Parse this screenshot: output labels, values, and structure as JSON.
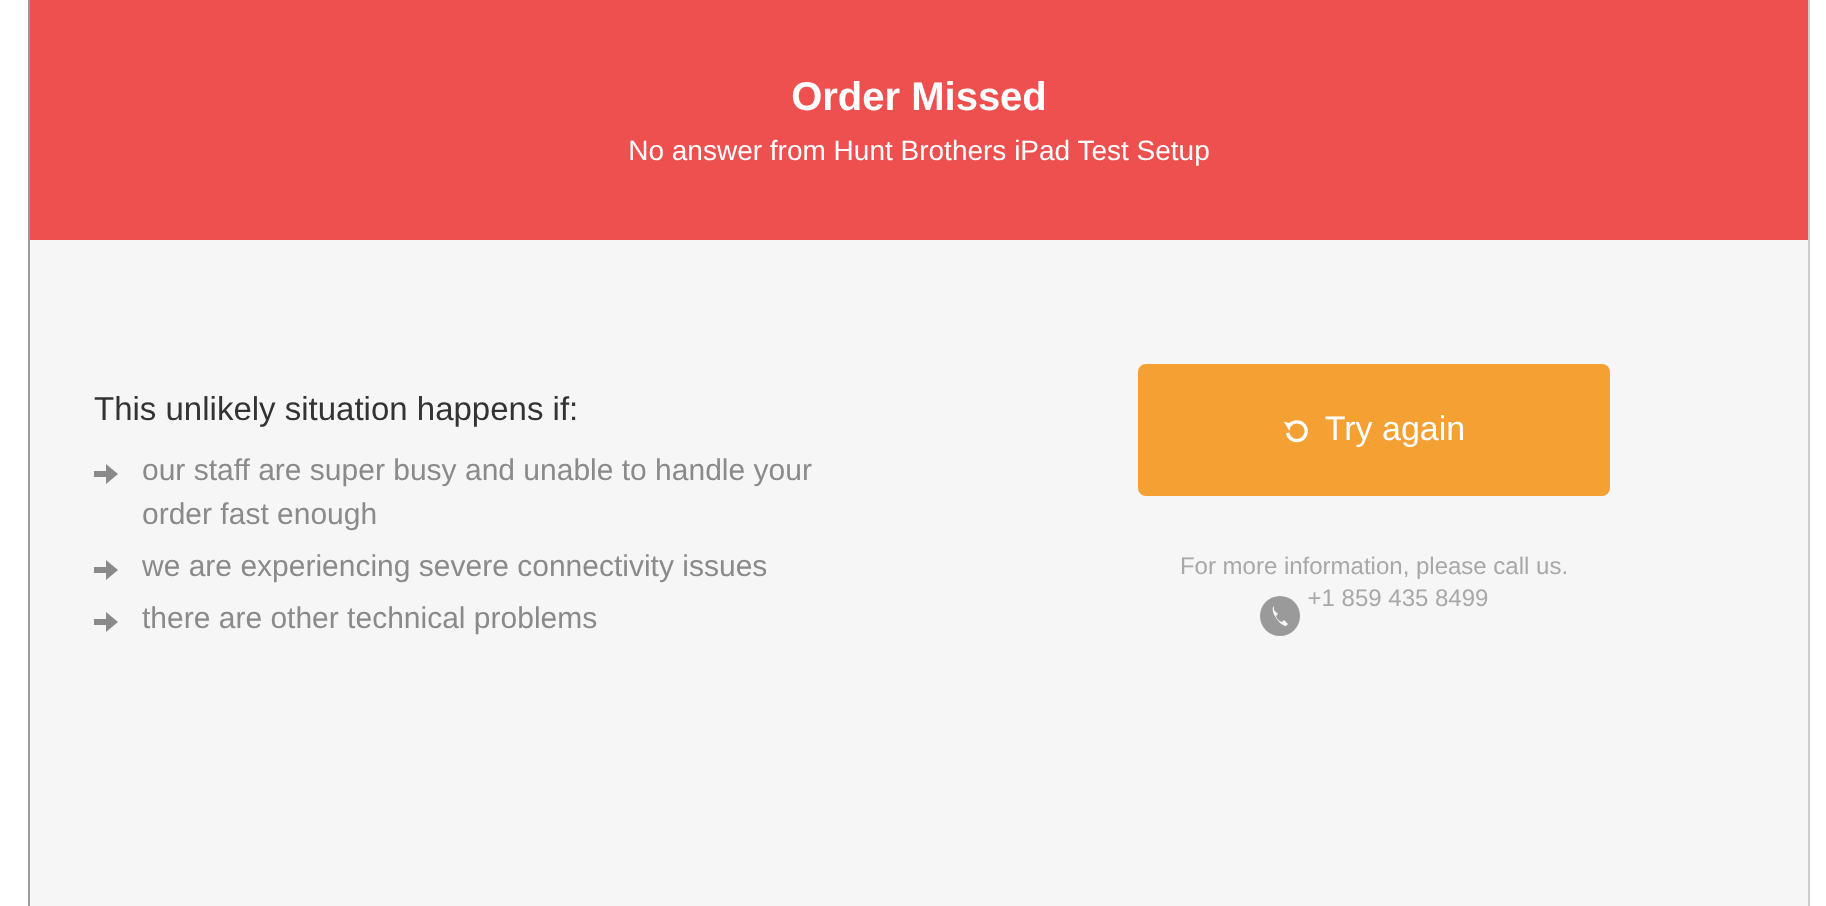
{
  "header": {
    "title": "Order Missed",
    "subtitle": "No answer from Hunt Brothers iPad Test Setup"
  },
  "reasons": {
    "heading": "This unlikely situation happens if:",
    "items": [
      {
        "text": "our staff are super busy and unable to handle your order fast enough"
      },
      {
        "text": "we are experiencing severe connectivity issues"
      },
      {
        "text": "there are other technical problems"
      }
    ]
  },
  "retry_button": {
    "label": "Try again"
  },
  "contact": {
    "note": "For more information, please call us.",
    "phone": "+1 859 435 8499"
  }
}
